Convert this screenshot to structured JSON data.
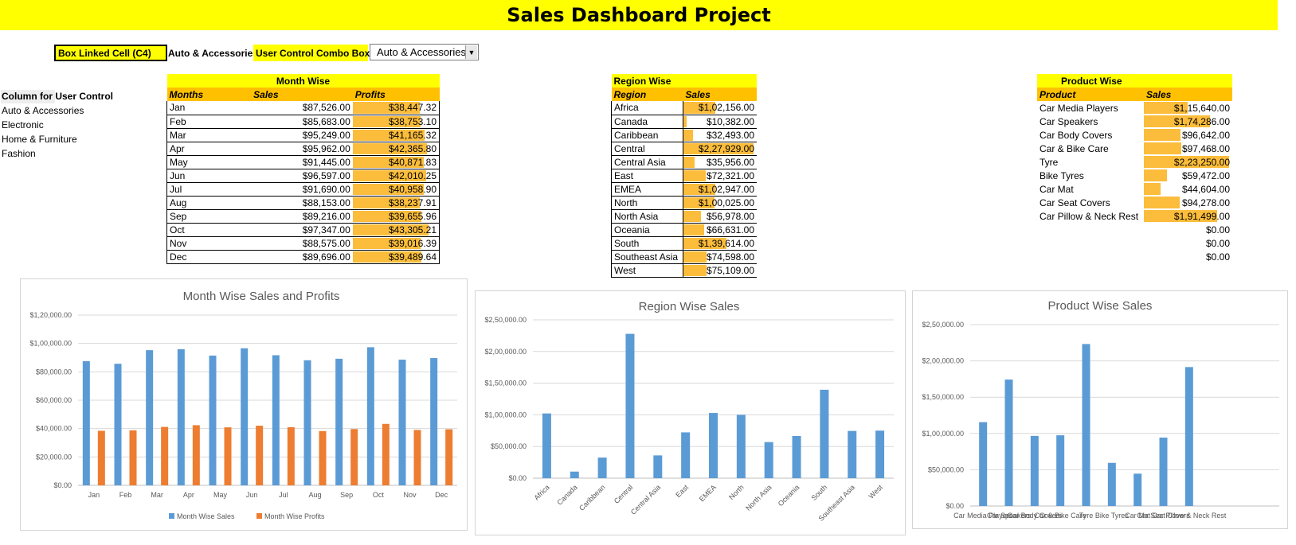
{
  "title": "Sales Dashboard Project",
  "controls": {
    "linked_cell_label": "Box Linked Cell (C4)",
    "linked_cell_value": "Auto & Accessories",
    "combo_label": "User Control Combo Box",
    "combo_value": "Auto & Accessories"
  },
  "user_control": {
    "header": "Column for User Control",
    "items": [
      "Auto & Accessories",
      "Electronic",
      "Home & Furniture",
      "Fashion"
    ]
  },
  "month_table": {
    "title": "Month Wise",
    "headers": [
      "Months",
      "Sales",
      "Profits"
    ],
    "rows": [
      [
        "Jan",
        "$87,526.00",
        "$38,447.32"
      ],
      [
        "Feb",
        "$85,683.00",
        "$38,753.10"
      ],
      [
        "Mar",
        "$95,249.00",
        "$41,165.32"
      ],
      [
        "Apr",
        "$95,962.00",
        "$42,365.80"
      ],
      [
        "May",
        "$91,445.00",
        "$40,871.83"
      ],
      [
        "Jun",
        "$96,597.00",
        "$42,010.25"
      ],
      [
        "Jul",
        "$91,690.00",
        "$40,958.90"
      ],
      [
        "Aug",
        "$88,153.00",
        "$38,237.91"
      ],
      [
        "Sep",
        "$89,216.00",
        "$39,655.96"
      ],
      [
        "Oct",
        "$97,347.00",
        "$43,305.21"
      ],
      [
        "Nov",
        "$88,575.00",
        "$39,016.39"
      ],
      [
        "Dec",
        "$89,696.00",
        "$39,489.64"
      ]
    ],
    "profit_fill": [
      0.88,
      0.89,
      0.95,
      0.98,
      0.94,
      0.97,
      0.94,
      0.88,
      0.91,
      1.0,
      0.9,
      0.91
    ]
  },
  "region_table": {
    "title": "Region Wise",
    "headers": [
      "Region",
      "Sales"
    ],
    "rows": [
      [
        "Africa",
        "$1,02,156.00"
      ],
      [
        "Canada",
        "$10,382.00"
      ],
      [
        "Caribbean",
        "$32,493.00"
      ],
      [
        "Central",
        "$2,27,929.00"
      ],
      [
        "Central Asia",
        "$35,956.00"
      ],
      [
        "East",
        "$72,321.00"
      ],
      [
        "EMEA",
        "$1,02,947.00"
      ],
      [
        "North",
        "$1,00,025.00"
      ],
      [
        "North Asia",
        "$56,978.00"
      ],
      [
        "Oceania",
        "$66,631.00"
      ],
      [
        "South",
        "$1,39,614.00"
      ],
      [
        "Southeast Asia",
        "$74,598.00"
      ],
      [
        "West",
        "$75,109.00"
      ]
    ],
    "sales_fill": [
      0.45,
      0.05,
      0.14,
      1.0,
      0.16,
      0.32,
      0.45,
      0.44,
      0.25,
      0.29,
      0.61,
      0.33,
      0.33
    ]
  },
  "product_table": {
    "title": "Product Wise",
    "headers": [
      "Product",
      "Sales"
    ],
    "rows": [
      [
        "Car Media Players",
        "$1,15,640.00"
      ],
      [
        "Car Speakers",
        "$1,74,286.00"
      ],
      [
        "Car Body Covers",
        "$96,642.00"
      ],
      [
        "Car & Bike Care",
        "$97,468.00"
      ],
      [
        "Tyre",
        "$2,23,250.00"
      ],
      [
        "Bike Tyres",
        "$59,472.00"
      ],
      [
        "Car Mat",
        "$44,604.00"
      ],
      [
        "Car Seat Covers",
        "$94,278.00"
      ],
      [
        "Car Pillow & Neck Rest",
        "$1,91,499.00"
      ],
      [
        "",
        "$0.00"
      ],
      [
        "",
        "$0.00"
      ],
      [
        "",
        "$0.00"
      ]
    ],
    "sales_fill": [
      0.52,
      0.78,
      0.43,
      0.44,
      1.0,
      0.27,
      0.2,
      0.42,
      0.86,
      0,
      0,
      0
    ]
  },
  "colors": {
    "sales": "#5b9bd5",
    "profits": "#ed7d31",
    "yellow": "#ffff00",
    "orange": "#ffc000",
    "databar": "#fbbd3b"
  },
  "chart_data": [
    {
      "type": "bar",
      "title": "Month Wise Sales and Profits",
      "categories": [
        "Jan",
        "Feb",
        "Mar",
        "Apr",
        "May",
        "Jun",
        "Jul",
        "Aug",
        "Sep",
        "Oct",
        "Nov",
        "Dec"
      ],
      "series": [
        {
          "name": "Month Wise Sales",
          "values": [
            87526,
            85683,
            95249,
            95962,
            91445,
            96597,
            91690,
            88153,
            89216,
            97347,
            88575,
            89696
          ]
        },
        {
          "name": "Month Wise Profits",
          "values": [
            38447.32,
            38753.1,
            41165.32,
            42365.8,
            40871.83,
            42010.25,
            40958.9,
            38237.91,
            39655.96,
            43305.21,
            39016.39,
            39489.64
          ]
        }
      ],
      "ylim": [
        0,
        120000
      ],
      "yticks": [
        "$0.00",
        "$20,000.00",
        "$40,000.00",
        "$60,000.00",
        "$80,000.00",
        "$1,00,000.00",
        "$1,20,000.00"
      ],
      "grid": true,
      "legend": "bottom"
    },
    {
      "type": "bar",
      "title": "Region Wise Sales",
      "categories": [
        "Africa",
        "Canada",
        "Caribbean",
        "Central",
        "Central Asia",
        "East",
        "EMEA",
        "North",
        "North Asia",
        "Oceania",
        "South",
        "Southeast Asia",
        "West"
      ],
      "series": [
        {
          "values": [
            102156,
            10382,
            32493,
            227929,
            35956,
            72321,
            102947,
            100025,
            56978,
            66631,
            139614,
            74598,
            75109
          ]
        }
      ],
      "ylim": [
        0,
        250000
      ],
      "yticks": [
        "$0.00",
        "$50,000.00",
        "$1,00,000.00",
        "$1,50,000.00",
        "$2,00,000.00",
        "$2,50,000.00"
      ],
      "grid": true
    },
    {
      "type": "bar",
      "title": "Product Wise Sales",
      "categories": [
        "Car Media Players",
        "Car Speakers",
        "Car Body Covers",
        "Car & Bike Care",
        "Tyre",
        "Bike Tyres",
        "Car Mat",
        "Car Seat Covers",
        "Car Pillow & Neck Rest",
        "",
        "",
        ""
      ],
      "series": [
        {
          "values": [
            115640,
            174286,
            96642,
            97468,
            223250,
            59472,
            44604,
            94278,
            191499,
            0,
            0,
            0
          ]
        }
      ],
      "ylim": [
        0,
        250000
      ],
      "yticks": [
        "$0.00",
        "$50,000.00",
        "$1,00,000.00",
        "$1,50,000.00",
        "$2,00,000.00",
        "$2,50,000.00"
      ],
      "grid": true
    }
  ]
}
